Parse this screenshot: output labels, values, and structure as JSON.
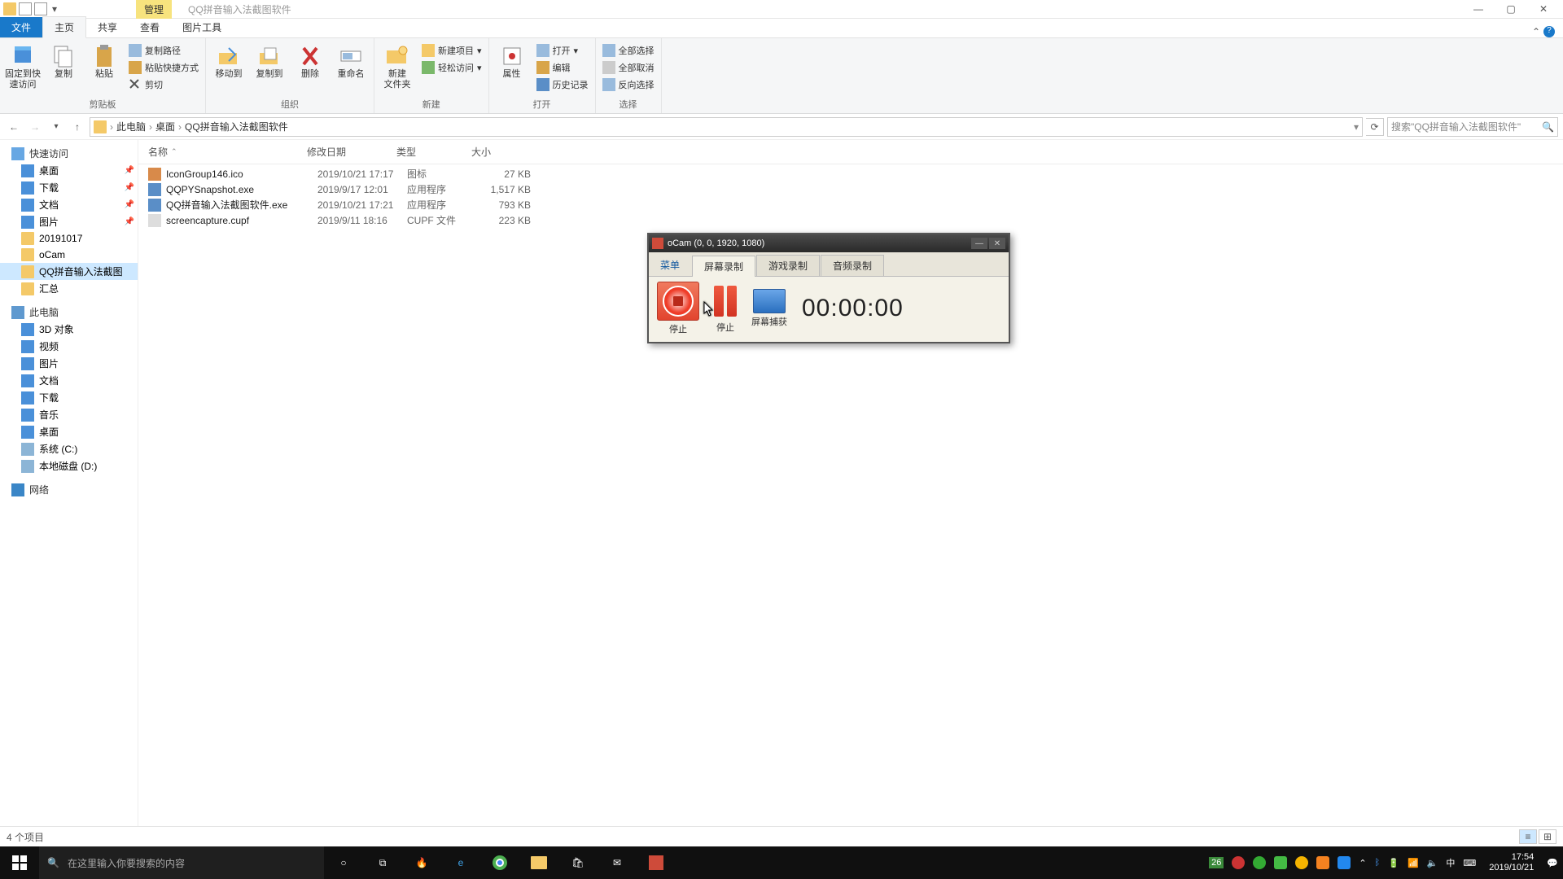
{
  "window": {
    "contextual_tab": "管理",
    "title": "QQ拼音输入法截图软件"
  },
  "tabs": {
    "file": "文件",
    "home": "主页",
    "share": "共享",
    "view": "查看",
    "picture": "图片工具"
  },
  "ribbon": {
    "pin": "固定到快\n速访问",
    "copy": "复制",
    "paste": "粘贴",
    "copypath": "复制路径",
    "pasteshortcut": "粘贴快捷方式",
    "cut": "剪切",
    "clipboard": "剪贴板",
    "moveto": "移动到",
    "copyto": "复制到",
    "delete": "删除",
    "rename": "重命名",
    "organize": "组织",
    "newfolder": "新建\n文件夹",
    "newitem": "新建项目",
    "easyaccess": "轻松访问",
    "new": "新建",
    "properties": "属性",
    "open_btn": "打开",
    "edit": "编辑",
    "history": "历史记录",
    "open": "打开",
    "selectall": "全部选择",
    "selectnone": "全部取消",
    "invert": "反向选择",
    "select": "选择"
  },
  "breadcrumb": {
    "pc": "此电脑",
    "desktop": "桌面",
    "folder": "QQ拼音输入法截图软件"
  },
  "search": {
    "placeholder": "搜索\"QQ拼音输入法截图软件\""
  },
  "nav": {
    "quick": "快速访问",
    "desktop": "桌面",
    "downloads": "下载",
    "docs": "文档",
    "pictures": "图片",
    "d20191017": "20191017",
    "ocam": "oCam",
    "qqfolder": "QQ拼音输入法截图",
    "huizong": "汇总",
    "thispc": "此电脑",
    "obj3d": "3D 对象",
    "video": "视频",
    "pics2": "图片",
    "docs2": "文档",
    "downloads2": "下载",
    "music": "音乐",
    "desktop2": "桌面",
    "cdrive": "系统 (C:)",
    "ddrive": "本地磁盘 (D:)",
    "network": "网络"
  },
  "columns": {
    "name": "名称",
    "date": "修改日期",
    "type": "类型",
    "size": "大小"
  },
  "files": [
    {
      "icon": "ico",
      "name": "IconGroup146.ico",
      "date": "2019/10/21 17:17",
      "type": "图标",
      "size": "27 KB"
    },
    {
      "icon": "exe",
      "name": "QQPYSnapshot.exe",
      "date": "2019/9/17 12:01",
      "type": "应用程序",
      "size": "1,517 KB"
    },
    {
      "icon": "exe",
      "name": "QQ拼音输入法截图软件.exe",
      "date": "2019/10/21 17:21",
      "type": "应用程序",
      "size": "793 KB"
    },
    {
      "icon": "file",
      "name": "screencapture.cupf",
      "date": "2019/9/11 18:16",
      "type": "CUPF 文件",
      "size": "223 KB"
    }
  ],
  "status": {
    "items": "4 个项目"
  },
  "taskbar": {
    "search": "在这里输入你要搜索的内容",
    "time": "17:54",
    "date": "2019/10/21",
    "ime": "中",
    "tempbadge": "26"
  },
  "ocam": {
    "title": "oCam (0, 0, 1920, 1080)",
    "menu": "菜单",
    "tab_screen": "屏幕录制",
    "tab_game": "游戏录制",
    "tab_audio": "音频录制",
    "stop": "停止",
    "pause": "停止",
    "capture": "屏幕捕获",
    "time": "00:00:00"
  }
}
